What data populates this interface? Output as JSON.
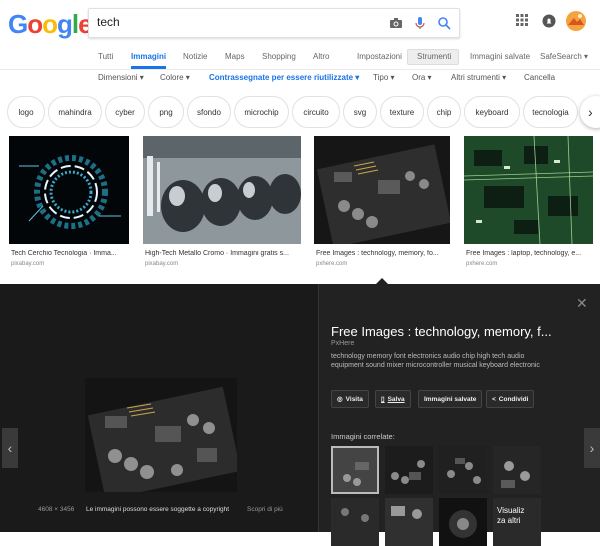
{
  "logo": {
    "l1": "G",
    "l2": "o",
    "l3": "o",
    "l4": "g",
    "l5": "l",
    "l6": "e"
  },
  "search": {
    "value": "tech"
  },
  "tabs": [
    "Tutti",
    "Immagini",
    "Notizie",
    "Maps",
    "Shopping",
    "Altro",
    "Impostazioni",
    "Strumenti",
    "Immagini salvate",
    "SafeSearch ▾"
  ],
  "filters": [
    "Dimensioni ▾",
    "Colore ▾",
    "Contrassegnate per essere riutilizzate ▾",
    "Tipo ▾",
    "Ora ▾",
    "Altri strumenti ▾",
    "Cancella"
  ],
  "chips": [
    "logo",
    "mahindra",
    "cyber",
    "png",
    "sfondo",
    "microchip",
    "circuito",
    "svg",
    "texture",
    "chip",
    "keyboard",
    "tecnologia"
  ],
  "results": [
    {
      "caption": "Tech Cerchio Tecnologia · Imma...",
      "source": "pixabay.com"
    },
    {
      "caption": "High-Tech Metallo Cromo · Immagini gratis s...",
      "source": "pixabay.com"
    },
    {
      "caption": "Free Images : technology, memory, fo...",
      "source": "pxhere.com"
    },
    {
      "caption": "Free Images : laptop, technology, e...",
      "source": "pxhere.com"
    }
  ],
  "panel": {
    "title": "Free Images : technology, memory, f...",
    "source": "PxHere",
    "description": "technology memory font electronics audio chip high tech audio equipment sound mixer microcontroller musical keyboard electronic",
    "buttons": [
      "Visita",
      "Salva",
      "Immagini salvate",
      "Condividi"
    ],
    "related_title": "Immagini correlate:",
    "more_label_1": "Visualiz",
    "more_label_2": "za altri",
    "dimensions": "4608 × 3456",
    "copyright": "Le immagini possono essere soggette a copyright",
    "learn_more": "Scopri di più"
  },
  "colors": {
    "accent": "#1a73e8",
    "panel_bg": "#222222"
  }
}
